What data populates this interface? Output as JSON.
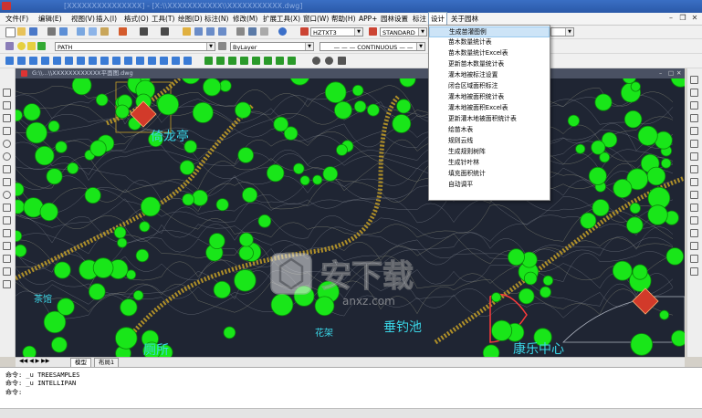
{
  "titlebar": {
    "title": "[XXXXXXXXXXXXXXX] - [X:\\\\XXXXXXXXXXX\\\\XXXXXXXXXXX.dwg]"
  },
  "menubar": {
    "items": [
      "文件(F)",
      "编辑(E)",
      "视图(V)",
      "插入(I)",
      "格式(O)",
      "工具(T)",
      "绘图(D)",
      "标注(N)",
      "修改(M)",
      "扩展工具(X)",
      "窗口(W)",
      "帮助(H)",
      "APP+",
      "园林设置",
      "标注",
      "设计",
      "关于园林"
    ]
  },
  "toolbar2": {
    "layer": "PATH"
  },
  "toolbar1": {
    "textstyle": "HZTXT3",
    "dimstyle": "STANDARD"
  },
  "properties": {
    "color": "ByLayer",
    "linetype": "CONTINUOUS"
  },
  "dropdown": {
    "items": [
      "生成苗灌图例",
      "苗木数量统计表",
      "苗木数量统计Excel表",
      "更新苗木数量统计表",
      "灌木地被标注设置",
      "闭合区域面积标注",
      "灌木地被面积统计表",
      "灌木地被面积Excel表",
      "更新灌木地被面积统计表",
      "绘苗木表",
      "规则云线",
      "生成规则树阵",
      "生成针叶林",
      "填充面积统计",
      "自动调平"
    ]
  },
  "document": {
    "tab_title": "G:\\\\...\\\\XXXXXXXXXXXX平面图.dwg"
  },
  "drawing": {
    "labels": [
      "倚龙亭",
      "茶馆",
      "垂钓池",
      "厕所",
      "康乐中心",
      "花架"
    ]
  },
  "watermark": {
    "text": "安下载",
    "sub": "anxz.com"
  },
  "layout_tabs": [
    "模型",
    "布局1"
  ],
  "command": {
    "lines": [
      "命令: _u TREESAMPLES",
      "命令: _u INTELLIPAN"
    ],
    "prompt": "命令:"
  },
  "colors": {
    "drawing_bg": "#1f2533",
    "tree_green": "#19e619",
    "pave_yellow": "#c9a227",
    "label_cyan": "#3ad7e8",
    "roof_red": "#d23a2a"
  }
}
